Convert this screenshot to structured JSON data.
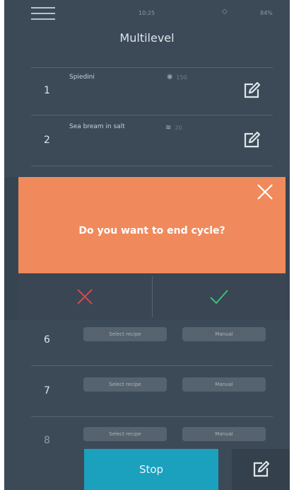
{
  "status_bar": {
    "time": "10:25",
    "wifi_icon": "wifi-icon",
    "battery": "84%"
  },
  "title": "Multilevel",
  "rows": [
    {
      "number": "1",
      "name": "Spiedini",
      "meta_icon": "fan-icon",
      "meta": "150"
    },
    {
      "number": "2",
      "name": "Sea bream in salt",
      "meta_icon": "steam-icon",
      "meta": "20"
    }
  ],
  "dialog": {
    "message": "Do you want to end cycle?",
    "cancel_icon": "cross-icon",
    "confirm_icon": "check-icon",
    "cancel_color": "#d9484b",
    "confirm_color": "#39c07a"
  },
  "levels": [
    {
      "number": "6",
      "select_label": "Select recipe",
      "manual_label": "Manual"
    },
    {
      "number": "7",
      "select_label": "Select recipe",
      "manual_label": "Manual"
    },
    {
      "number": "8",
      "select_label": "Select recipe",
      "manual_label": "Manual"
    }
  ],
  "stop_label": "Stop",
  "colors": {
    "background": "#3c4a58",
    "accent": "#1ba0bd",
    "dialog": "#f08a5c"
  }
}
